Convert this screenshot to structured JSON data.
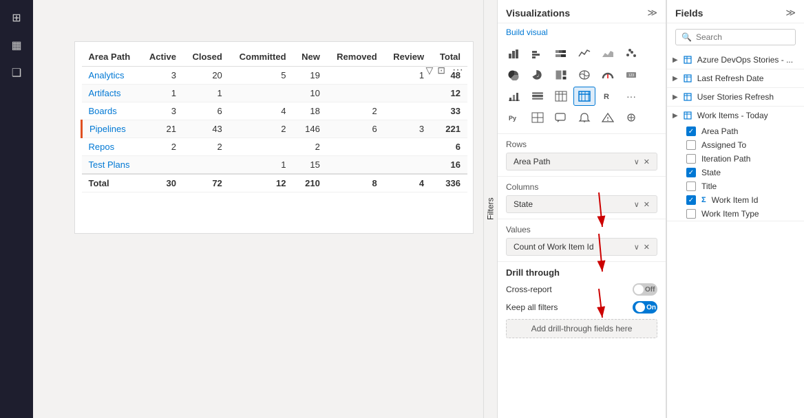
{
  "sidebar": {
    "icons": [
      {
        "name": "grid-icon",
        "symbol": "⊞",
        "active": false
      },
      {
        "name": "table-icon",
        "symbol": "▦",
        "active": false
      },
      {
        "name": "layers-icon",
        "symbol": "❑",
        "active": false
      }
    ]
  },
  "filters_label": "Filters",
  "matrix": {
    "columns": [
      "Area Path",
      "Active",
      "Closed",
      "Committed",
      "New",
      "Removed",
      "Review",
      "Total"
    ],
    "rows": [
      {
        "areaPath": "Analytics",
        "active": "3",
        "closed": "20",
        "committed": "5",
        "new": "19",
        "removed": "",
        "review": "1",
        "total": "48",
        "highlight": false
      },
      {
        "areaPath": "Artifacts",
        "active": "1",
        "closed": "1",
        "committed": "",
        "new": "10",
        "removed": "",
        "review": "",
        "total": "12",
        "highlight": false
      },
      {
        "areaPath": "Boards",
        "active": "3",
        "closed": "6",
        "committed": "4",
        "new": "18",
        "removed": "2",
        "review": "",
        "total": "33",
        "highlight": false
      },
      {
        "areaPath": "Pipelines",
        "active": "21",
        "closed": "43",
        "committed": "2",
        "new": "146",
        "removed": "6",
        "review": "3",
        "total": "221",
        "highlight": true
      },
      {
        "areaPath": "Repos",
        "active": "2",
        "closed": "2",
        "committed": "",
        "new": "2",
        "removed": "",
        "review": "",
        "total": "6",
        "highlight": false
      },
      {
        "areaPath": "Test Plans",
        "active": "",
        "closed": "",
        "committed": "1",
        "new": "15",
        "removed": "",
        "review": "",
        "total": "16",
        "highlight": false
      }
    ],
    "total_row": {
      "label": "Total",
      "active": "30",
      "closed": "72",
      "committed": "12",
      "new": "210",
      "removed": "8",
      "review": "4",
      "total": "336"
    }
  },
  "visualizations_panel": {
    "title": "Visualizations",
    "build_visual_label": "Build visual",
    "chart_rows": [
      [
        "▦",
        "📊",
        "▤",
        "📈",
        "📉",
        "📊"
      ],
      [
        "△",
        "〰",
        "▦",
        "📊",
        "📈",
        "⬛"
      ],
      [
        "⬤",
        "🍩",
        "🗺",
        "R",
        "Σ",
        "⋯"
      ],
      [
        "Py",
        "⊞",
        "💬",
        "🔔",
        "🏆",
        "⚙"
      ]
    ],
    "matrix_tooltip": "Matrix",
    "selected_chart": "matrix",
    "rows_section": {
      "label": "Rows",
      "value": "Area Path"
    },
    "columns_section": {
      "label": "Columns",
      "value": "State"
    },
    "values_section": {
      "label": "Values",
      "value": "Count of Work Item Id"
    },
    "drillthrough": {
      "title": "Drill through",
      "cross_report_label": "Cross-report",
      "cross_report_value": "Off",
      "keep_filters_label": "Keep all filters",
      "keep_filters_value": "On",
      "add_label": "Add drill-through fields here"
    }
  },
  "fields_panel": {
    "title": "Fields",
    "search_placeholder": "Search",
    "groups": [
      {
        "name": "Azure DevOps Stories - ...",
        "expanded": false,
        "items": []
      },
      {
        "name": "Last Refresh Date",
        "expanded": false,
        "items": []
      },
      {
        "name": "User Stories Refresh",
        "expanded": false,
        "items": []
      },
      {
        "name": "Work Items - Today",
        "expanded": true,
        "items": [
          {
            "name": "Area Path",
            "checked": true,
            "sigma": false
          },
          {
            "name": "Assigned To",
            "checked": false,
            "sigma": false
          },
          {
            "name": "Iteration Path",
            "checked": false,
            "sigma": false
          },
          {
            "name": "State",
            "checked": true,
            "sigma": false
          },
          {
            "name": "Title",
            "checked": false,
            "sigma": false
          },
          {
            "name": "Work Item Id",
            "checked": true,
            "sigma": true
          },
          {
            "name": "Work Item Type",
            "checked": false,
            "sigma": false
          }
        ]
      }
    ]
  }
}
